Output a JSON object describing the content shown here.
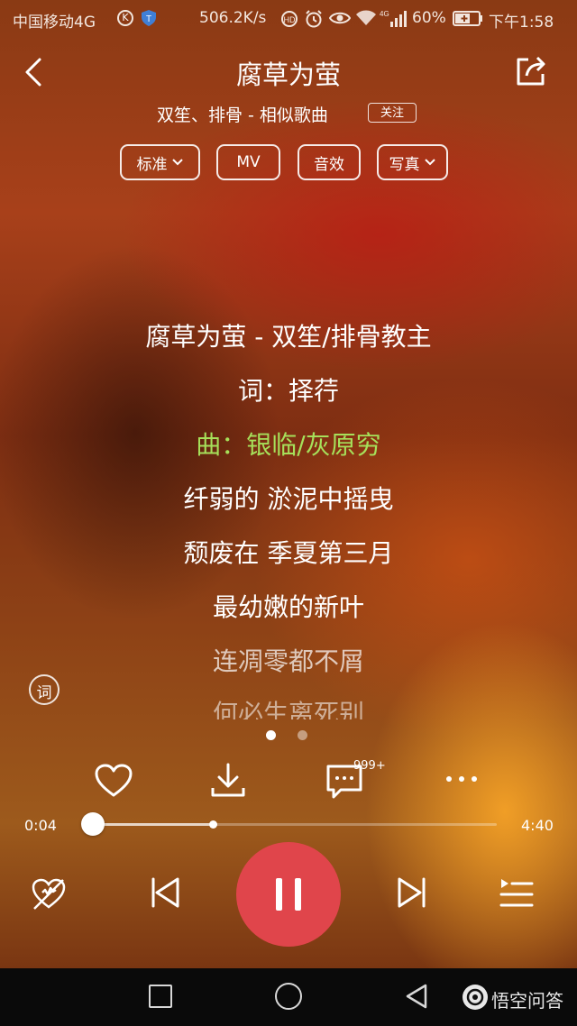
{
  "status_bar": {
    "carrier": "中国移动4G",
    "speed": "506.2K/s",
    "battery": "60%",
    "time": "下午1:58"
  },
  "header": {
    "title": "腐草为萤",
    "subtitle": "双笙、排骨 - 相似歌曲",
    "follow_label": "关注"
  },
  "chips": [
    {
      "label": "标准",
      "has_dropdown": true
    },
    {
      "label": "MV",
      "has_dropdown": false
    },
    {
      "label": "音效",
      "has_dropdown": false
    },
    {
      "label": "写真",
      "has_dropdown": true
    }
  ],
  "lyrics": {
    "active_color": "#a6e05a",
    "lines": [
      {
        "text": "腐草为萤 - 双笙/排骨教主",
        "active": false
      },
      {
        "text": "词：择荇",
        "active": false
      },
      {
        "text": "曲：银临/灰原穷",
        "active": true
      },
      {
        "text": "纤弱的 淤泥中摇曳",
        "active": false
      },
      {
        "text": "颓废在 季夏第三月",
        "active": false
      },
      {
        "text": "最幼嫩的新叶",
        "active": false
      },
      {
        "text": "连凋零都不屑",
        "active": false
      },
      {
        "text": "何必生离死别",
        "active": false
      }
    ],
    "lyric_toggle_label": "词"
  },
  "pager": {
    "count": 2,
    "active_index": 0
  },
  "actions": {
    "comment_count": "999+"
  },
  "progress": {
    "current": "0:04",
    "total": "4:40",
    "played_fraction": 0.017,
    "buffered_fraction": 0.31
  },
  "player": {
    "accent_color": "#e0454b",
    "state": "playing"
  },
  "watermark": "悟空问答"
}
